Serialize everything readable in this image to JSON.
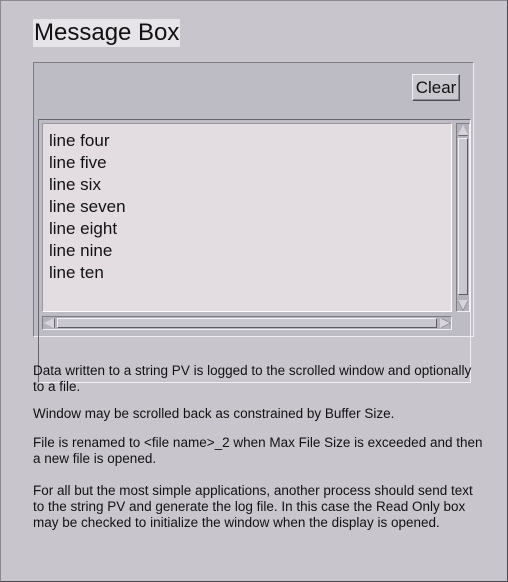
{
  "window": {
    "title": "Message Box"
  },
  "toolbar": {
    "clear_label": "Clear"
  },
  "message_log": {
    "lines": [
      "line four",
      "line five",
      "line six",
      "line seven",
      "line eight",
      "line nine",
      "line ten"
    ]
  },
  "description": {
    "p1": "Data written to a string PV is logged to the scrolled window and optionally to a file.",
    "p2": "Window may be scrolled back as constrained by Buffer Size.",
    "p3": "File is renamed to <file name>_2 when Max File Size is exceeded and then a new file is opened.",
    "p4": "For all but the most simple applications, another process should send text to the string PV and generate the log file. In this case the Read Only box may be checked to initialize the window when the display is opened."
  }
}
